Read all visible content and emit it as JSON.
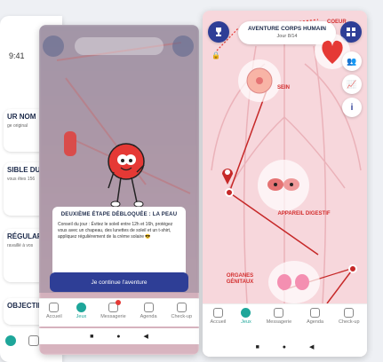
{
  "left_phone": {
    "status": "9:41",
    "card_titles": [
      "UR NOM",
      "SIBLE DUEL",
      "RÉGULARITÉ",
      "OBJECTIF"
    ],
    "card_subtitles": [
      "ge original",
      "vous êtes 156",
      "ravaillé à vos",
      ""
    ]
  },
  "middle_phone": {
    "popup": {
      "title": "DEUXIÈME ÉTAPE DÉBLOQUÉE : LA PEAU",
      "text": "Conseil du jour : Évitez le soleil entre 12h et 16h, protégez vous avec un chapeau, des lunettes de soleil et un t-shirt, appliquez régulièrement de la crème solaire 😎"
    },
    "continue_button": "Je continue l'aventure",
    "nav": [
      "Accueil",
      "Jeux",
      "Messagerie",
      "Agenda",
      "Check-up"
    ]
  },
  "right_phone": {
    "title": "AVENTURE CORPS HUMAIN",
    "day": "Jour 8/14",
    "labels": {
      "coeur": "COEUR",
      "sein": "SEIN",
      "appareil_digestif": "APPAREIL DIGESTIF",
      "organes_genitaux": "ORGANES GÉNITAUX"
    },
    "nav": [
      "Accueil",
      "Jeux",
      "Messagerie",
      "Agenda",
      "Check-up"
    ]
  },
  "system_buttons": [
    "■",
    "●",
    "◀"
  ],
  "colors": {
    "accent": "#1ea69a",
    "primary": "#2e3e96",
    "organ_red": "#d32f2f"
  }
}
